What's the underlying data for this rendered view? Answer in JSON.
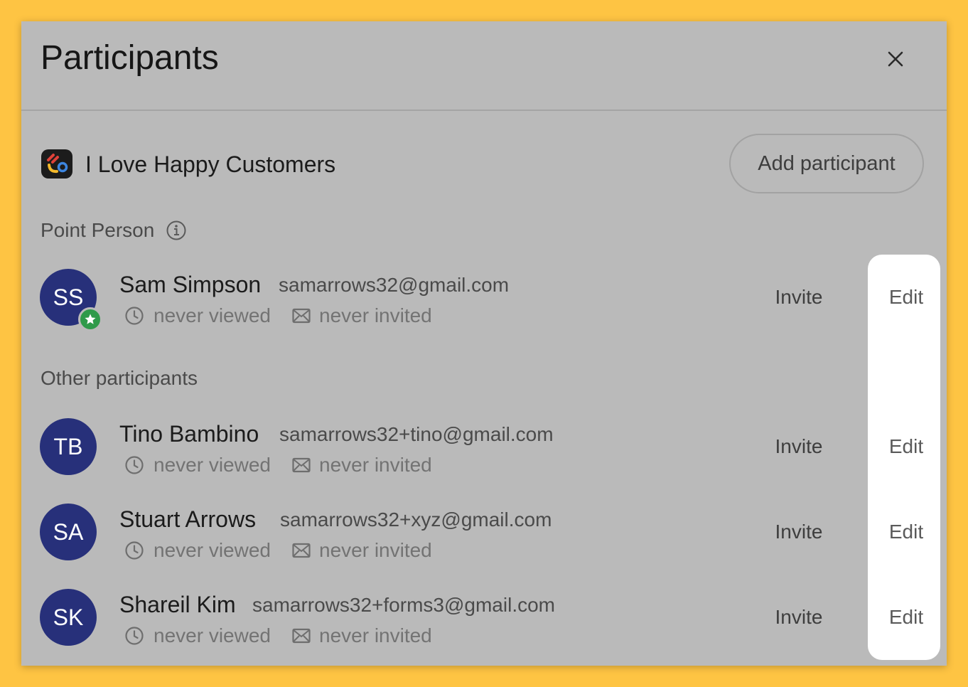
{
  "modal": {
    "title": "Participants"
  },
  "project": {
    "name": "I Love Happy Customers",
    "add_button": "Add participant"
  },
  "sections": {
    "point_person": "Point Person",
    "other": "Other participants"
  },
  "point_person": {
    "initials": "SS",
    "name": "Sam Simpson",
    "email": "samarrows32@gmail.com",
    "viewed": "never viewed",
    "invited": "never invited",
    "invite_label": "Invite",
    "edit_label": "Edit"
  },
  "participants": [
    {
      "initials": "TB",
      "name": "Tino Bambino",
      "email": "samarrows32+tino@gmail.com",
      "viewed": "never viewed",
      "invited": "never invited",
      "invite_label": "Invite",
      "edit_label": "Edit"
    },
    {
      "initials": "SA",
      "name": "Stuart Arrows",
      "email": "samarrows32+xyz@gmail.com",
      "viewed": "never viewed",
      "invited": "never invited",
      "invite_label": "Invite",
      "edit_label": "Edit"
    },
    {
      "initials": "SK",
      "name": "Shareil Kim",
      "email": "samarrows32+forms3@gmail.com",
      "viewed": "never viewed",
      "invited": "never invited",
      "invite_label": "Invite",
      "edit_label": "Edit"
    }
  ],
  "icons": {
    "close": "close-icon",
    "info": "info-icon",
    "clock": "clock-icon",
    "mail": "mail-icon",
    "star": "star-icon",
    "logo": "project-logo-icon"
  },
  "colors": {
    "background": "#fec443",
    "modal": "#bababa",
    "avatar": "#27307a",
    "badge": "#2f9a4a",
    "highlight": "#ffffff"
  }
}
